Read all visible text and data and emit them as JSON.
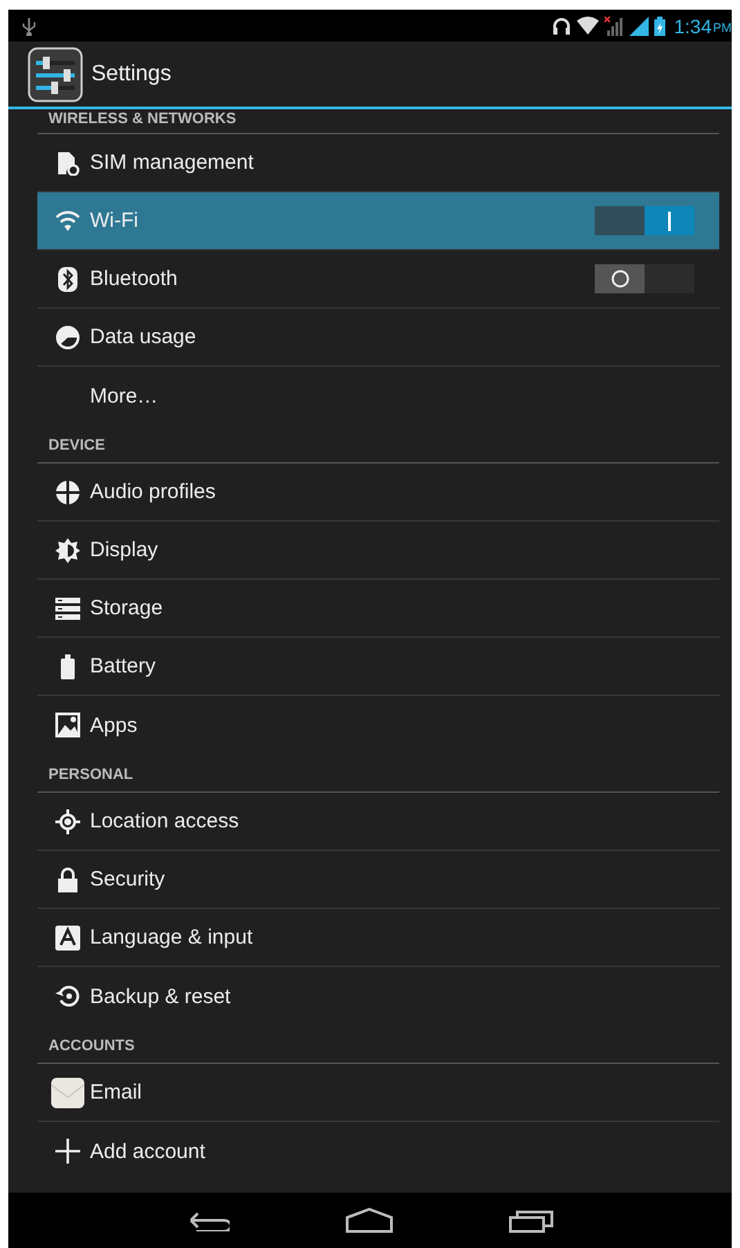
{
  "status_bar": {
    "time": "1:34",
    "period": "PM"
  },
  "action_bar": {
    "title": "Settings"
  },
  "sections": [
    {
      "header": "WIRELESS & NETWORKS",
      "items": [
        {
          "kind": "plain",
          "label": "SIM management",
          "selected": false
        },
        {
          "kind": "toggle",
          "label": "Wi-Fi",
          "selected": true,
          "on": true
        },
        {
          "kind": "toggle",
          "label": "Bluetooth",
          "selected": false,
          "on": false
        },
        {
          "kind": "plain",
          "label": "Data usage",
          "selected": false
        },
        {
          "kind": "plain",
          "label": "More…",
          "selected": false
        }
      ]
    },
    {
      "header": "DEVICE",
      "items": [
        {
          "kind": "plain",
          "label": "Audio profiles",
          "selected": false
        },
        {
          "kind": "plain",
          "label": "Display",
          "selected": false
        },
        {
          "kind": "plain",
          "label": "Storage",
          "selected": false
        },
        {
          "kind": "plain",
          "label": "Battery",
          "selected": false
        },
        {
          "kind": "plain",
          "label": "Apps",
          "selected": false
        }
      ]
    },
    {
      "header": "PERSONAL",
      "items": [
        {
          "kind": "plain",
          "label": "Location access",
          "selected": false
        },
        {
          "kind": "plain",
          "label": "Security",
          "selected": false
        },
        {
          "kind": "plain",
          "label": "Language & input",
          "selected": false
        },
        {
          "kind": "plain",
          "label": "Backup & reset",
          "selected": false
        }
      ]
    },
    {
      "header": "ACCOUNTS",
      "items": [
        {
          "kind": "plain",
          "label": "Email",
          "selected": false
        },
        {
          "kind": "plain",
          "label": "Add account",
          "selected": false
        }
      ]
    }
  ]
}
